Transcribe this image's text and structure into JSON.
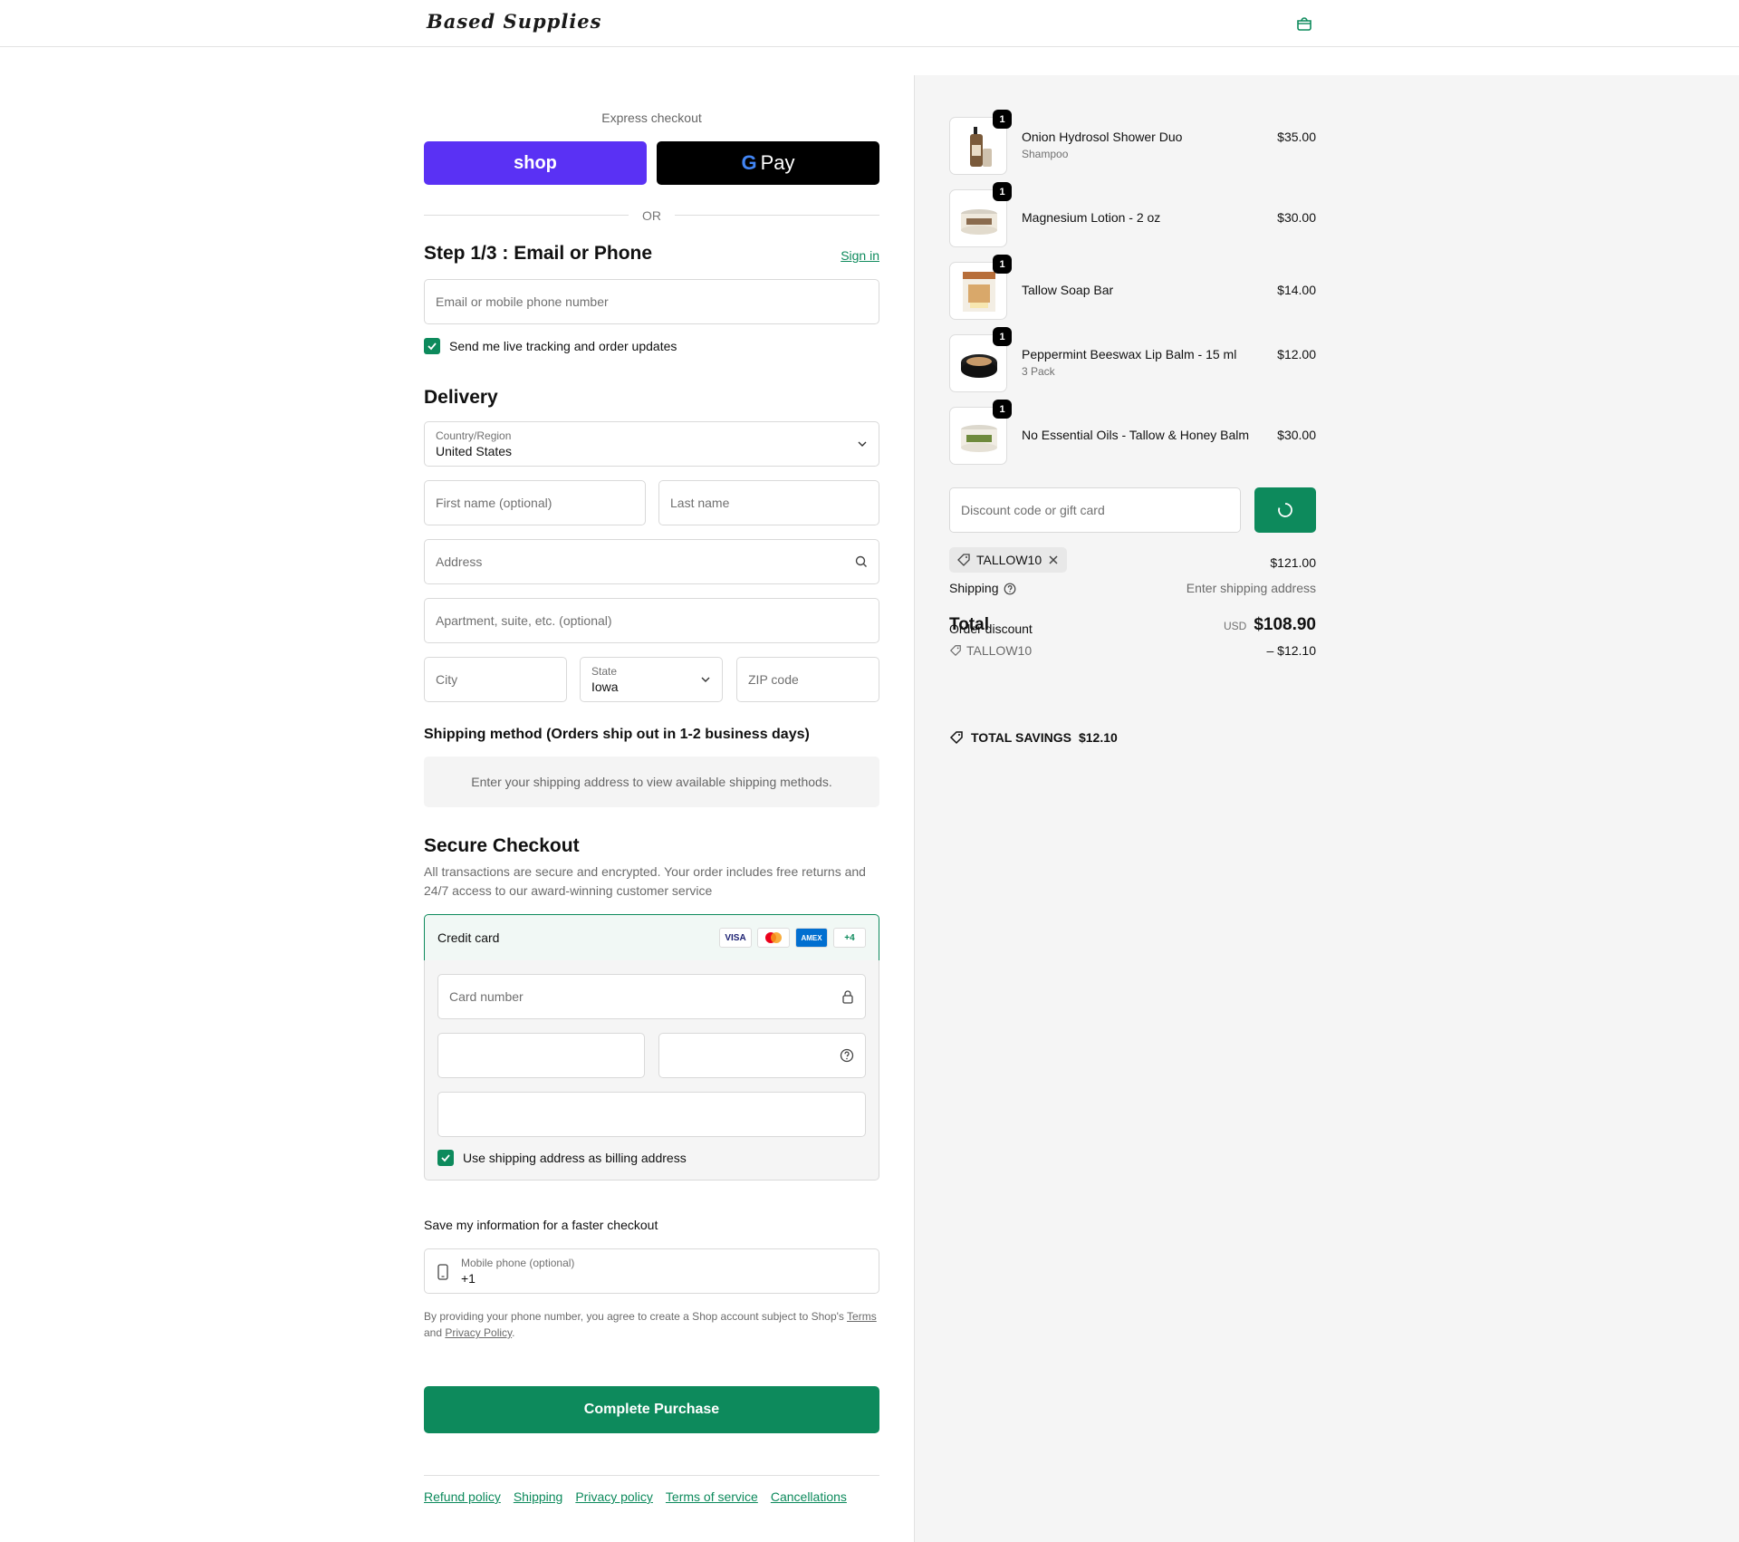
{
  "header": {
    "logo": "Based Supplies",
    "cart_icon": "bag-icon"
  },
  "express": {
    "title": "Express checkout",
    "shop_label": "shop",
    "gpay_g": "G",
    "gpay_label": "Pay",
    "or_label": "OR"
  },
  "contact": {
    "heading": "Step 1/3 : Email or Phone",
    "signin": "Sign in",
    "email_placeholder": "Email or mobile phone number",
    "tracking_label": "Send me live tracking and order updates",
    "tracking_checked": true
  },
  "delivery": {
    "heading": "Delivery",
    "country_label": "Country/Region",
    "country_value": "United States",
    "first_name": "First name (optional)",
    "last_name": "Last name",
    "address": "Address",
    "apartment": "Apartment, suite, etc. (optional)",
    "city": "City",
    "state_label": "State",
    "state_value": "Iowa",
    "zip": "ZIP code"
  },
  "shipping_method": {
    "heading": "Shipping method (Orders ship out in 1-2 business days)",
    "message": "Enter your shipping address to view available shipping methods."
  },
  "payment": {
    "heading": "Secure Checkout",
    "description": "All transactions are secure and encrypted. Your order includes free returns and 24/7 access to our award-winning customer service",
    "method": "Credit card",
    "cards": [
      "VISA",
      "mastercard",
      "AMEX",
      "+4"
    ],
    "card_number": "Card number",
    "billing_label": "Use shipping address as billing address",
    "billing_checked": true
  },
  "save_info": {
    "heading": "Save my information for a faster checkout",
    "phone_label": "Mobile phone (optional)",
    "phone_value": "+1",
    "legal_prefix": "By providing your phone number, you agree to create a Shop account subject to Shop's",
    "terms": "Terms",
    "and": "and",
    "privacy": "Privacy Policy",
    "period": "."
  },
  "complete_label": "Complete Purchase",
  "footer_links": [
    "Refund policy",
    "Shipping",
    "Privacy policy",
    "Terms of service",
    "Cancellations"
  ],
  "cart": {
    "items": [
      {
        "name": "Onion Hydrosol Shower Duo",
        "variant": "Shampoo",
        "price": "$35.00",
        "qty": "1"
      },
      {
        "name": "Magnesium Lotion - 2 oz",
        "variant": "",
        "price": "$30.00",
        "qty": "1"
      },
      {
        "name": "Tallow Soap Bar",
        "variant": "",
        "price": "$14.00",
        "qty": "1"
      },
      {
        "name": "Peppermint Beeswax Lip Balm - 15 ml",
        "variant": "3 Pack",
        "price": "$12.00",
        "qty": "1"
      },
      {
        "name": "No Essential Oils - Tallow & Honey Balm",
        "variant": "",
        "price": "$30.00",
        "qty": "1"
      }
    ],
    "discount_placeholder": "Discount code or gift card",
    "applied_code": "TALLOW10",
    "subtotal": "$121.00",
    "shipping_label": "Shipping",
    "shipping_value": "Enter shipping address",
    "order_discount_label": "Order discount",
    "discount_code": "TALLOW10",
    "discount_value": "– $12.10",
    "total_label": "Total",
    "currency": "USD",
    "total_value": "$108.90",
    "savings_label": "TOTAL SAVINGS",
    "savings_value": "$12.10"
  },
  "colors": {
    "accent": "#0d8a5c",
    "shop": "#5a31f4",
    "gpay": "#000000"
  }
}
